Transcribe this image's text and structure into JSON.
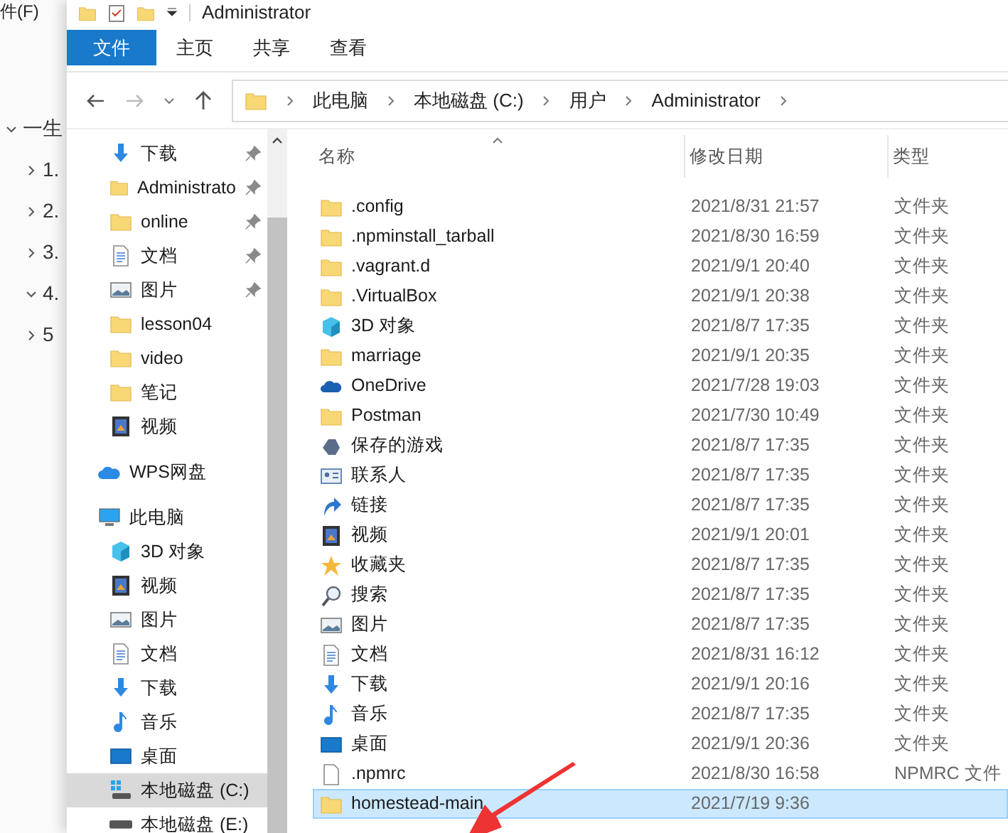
{
  "background_app": {
    "menu": [
      "件(F)"
    ],
    "tree": [
      {
        "text": "一生",
        "expanded": true,
        "children": [
          {
            "text": "1.",
            "expanded": false
          },
          {
            "text": "2.",
            "expanded": false
          },
          {
            "text": "3.",
            "expanded": false
          },
          {
            "text": "4.",
            "expanded": true
          },
          {
            "text": "5",
            "expanded": false
          }
        ]
      }
    ]
  },
  "window": {
    "title": "Administrator"
  },
  "ribbon_tabs": [
    {
      "label": "文件",
      "selected": true
    },
    {
      "label": "主页",
      "selected": false
    },
    {
      "label": "共享",
      "selected": false
    },
    {
      "label": "查看",
      "selected": false
    }
  ],
  "address": {
    "back_disabled": false,
    "forward_disabled": true,
    "breadcrumb": [
      "此电脑",
      "本地磁盘 (C:)",
      "用户",
      "Administrator"
    ]
  },
  "nav": {
    "quick_access": [
      {
        "label": "下载",
        "kind": "download",
        "pinned": true
      },
      {
        "label": "Administrato",
        "kind": "folder",
        "pinned": true
      },
      {
        "label": "online",
        "kind": "folder",
        "pinned": true
      },
      {
        "label": "文档",
        "kind": "doc",
        "pinned": true
      },
      {
        "label": "图片",
        "kind": "picture",
        "pinned": true
      },
      {
        "label": "lesson04",
        "kind": "folder",
        "pinned": false
      },
      {
        "label": "video",
        "kind": "folder",
        "pinned": false
      },
      {
        "label": "笔记",
        "kind": "folder",
        "pinned": false
      },
      {
        "label": "视频",
        "kind": "video",
        "pinned": false
      }
    ],
    "roots": [
      {
        "label": "WPS网盘",
        "kind": "cloud",
        "selected": false
      },
      {
        "label": "此电脑",
        "kind": "pc",
        "selected": false,
        "children": [
          {
            "label": "3D 对象",
            "kind": "cube",
            "selected": false
          },
          {
            "label": "视频",
            "kind": "video",
            "selected": false
          },
          {
            "label": "图片",
            "kind": "picture",
            "selected": false
          },
          {
            "label": "文档",
            "kind": "doc",
            "selected": false
          },
          {
            "label": "下载",
            "kind": "download",
            "selected": false
          },
          {
            "label": "音乐",
            "kind": "music",
            "selected": false
          },
          {
            "label": "桌面",
            "kind": "desktop",
            "selected": false
          },
          {
            "label": "本地磁盘 (C:)",
            "kind": "drive-win",
            "selected": true
          },
          {
            "label": "本地磁盘 (E:)",
            "kind": "drive",
            "selected": false
          }
        ]
      }
    ]
  },
  "table": {
    "columns": [
      "名称",
      "修改日期",
      "类型"
    ],
    "rows": [
      {
        "kind": "folder",
        "name": ".config",
        "date": "2021/8/31 21:57",
        "type": "文件夹",
        "selected": false
      },
      {
        "kind": "folder",
        "name": ".npminstall_tarball",
        "date": "2021/8/30 16:59",
        "type": "文件夹",
        "selected": false
      },
      {
        "kind": "folder",
        "name": ".vagrant.d",
        "date": "2021/9/1 20:40",
        "type": "文件夹",
        "selected": false
      },
      {
        "kind": "folder",
        "name": ".VirtualBox",
        "date": "2021/9/1 20:38",
        "type": "文件夹",
        "selected": false
      },
      {
        "kind": "cube",
        "name": "3D 对象",
        "date": "2021/8/7 17:35",
        "type": "文件夹",
        "selected": false
      },
      {
        "kind": "folder",
        "name": "marriage",
        "date": "2021/9/1 20:35",
        "type": "文件夹",
        "selected": false
      },
      {
        "kind": "onedrive",
        "name": "OneDrive",
        "date": "2021/7/28 19:03",
        "type": "文件夹",
        "selected": false
      },
      {
        "kind": "folder",
        "name": "Postman",
        "date": "2021/7/30 10:49",
        "type": "文件夹",
        "selected": false
      },
      {
        "kind": "games",
        "name": "保存的游戏",
        "date": "2021/8/7 17:35",
        "type": "文件夹",
        "selected": false
      },
      {
        "kind": "contacts",
        "name": "联系人",
        "date": "2021/8/7 17:35",
        "type": "文件夹",
        "selected": false
      },
      {
        "kind": "link",
        "name": "链接",
        "date": "2021/8/7 17:35",
        "type": "文件夹",
        "selected": false
      },
      {
        "kind": "video",
        "name": "视频",
        "date": "2021/9/1 20:01",
        "type": "文件夹",
        "selected": false
      },
      {
        "kind": "star",
        "name": "收藏夹",
        "date": "2021/8/7 17:35",
        "type": "文件夹",
        "selected": false
      },
      {
        "kind": "search",
        "name": "搜索",
        "date": "2021/8/7 17:35",
        "type": "文件夹",
        "selected": false
      },
      {
        "kind": "picture",
        "name": "图片",
        "date": "2021/8/7 17:35",
        "type": "文件夹",
        "selected": false
      },
      {
        "kind": "doc",
        "name": "文档",
        "date": "2021/8/31 16:12",
        "type": "文件夹",
        "selected": false
      },
      {
        "kind": "download",
        "name": "下载",
        "date": "2021/9/1 20:16",
        "type": "文件夹",
        "selected": false
      },
      {
        "kind": "music",
        "name": "音乐",
        "date": "2021/8/7 17:35",
        "type": "文件夹",
        "selected": false
      },
      {
        "kind": "desktop",
        "name": "桌面",
        "date": "2021/9/1 20:36",
        "type": "文件夹",
        "selected": false
      },
      {
        "kind": "file",
        "name": ".npmrc",
        "date": "2021/8/30 16:58",
        "type": "NPMRC 文件",
        "selected": false
      },
      {
        "kind": "folder",
        "name": "homestead-main",
        "date": "2021/7/19 9:36",
        "selected": true
      }
    ]
  }
}
